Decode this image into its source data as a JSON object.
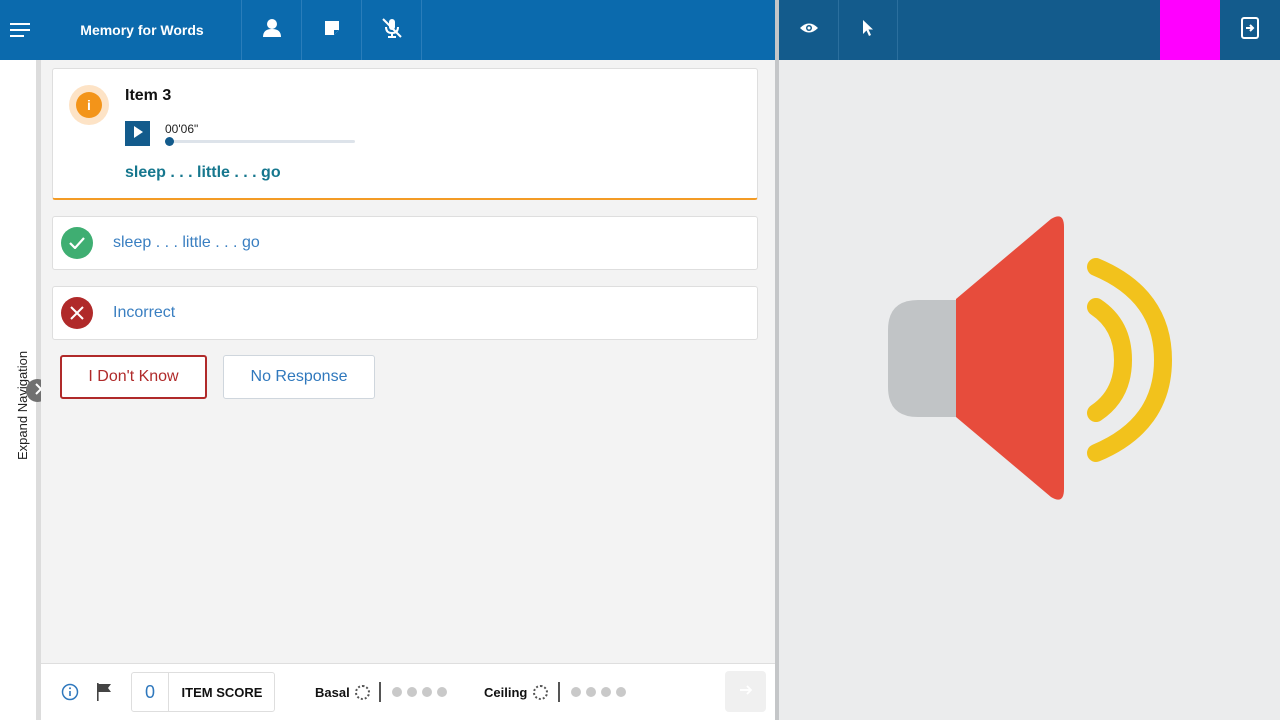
{
  "header": {
    "title": "Memory for Words",
    "icons": [
      "menu-icon",
      "person-icon",
      "note-icon",
      "mic-off-icon",
      "eye-icon",
      "pointer-icon",
      "device-switch-icon"
    ],
    "accent_color": "#0b6aad",
    "right_bar_color": "#135b8c",
    "marker_color": "#ff00ff"
  },
  "nav": {
    "expand_label": "Expand Navigation"
  },
  "item": {
    "title": "Item 3",
    "audio_time": "00'06\"",
    "audio_progress": 0.0,
    "prompt": "sleep . . . little . . . go"
  },
  "responses": [
    {
      "label": "sleep . . . little . . . go",
      "status": "correct",
      "color": "#3fae72"
    },
    {
      "label": "Incorrect",
      "status": "incorrect",
      "color": "#b02a2a"
    }
  ],
  "buttons": {
    "idk": "I Don't Know",
    "no_response": "No Response"
  },
  "footer": {
    "score_value": "0",
    "score_label": "ITEM SCORE",
    "basal_label": "Basal",
    "ceiling_label": "Ceiling",
    "basal_dots": 4,
    "ceiling_dots": 4
  },
  "stimulus": {
    "icon": "speaker-volume-icon"
  }
}
